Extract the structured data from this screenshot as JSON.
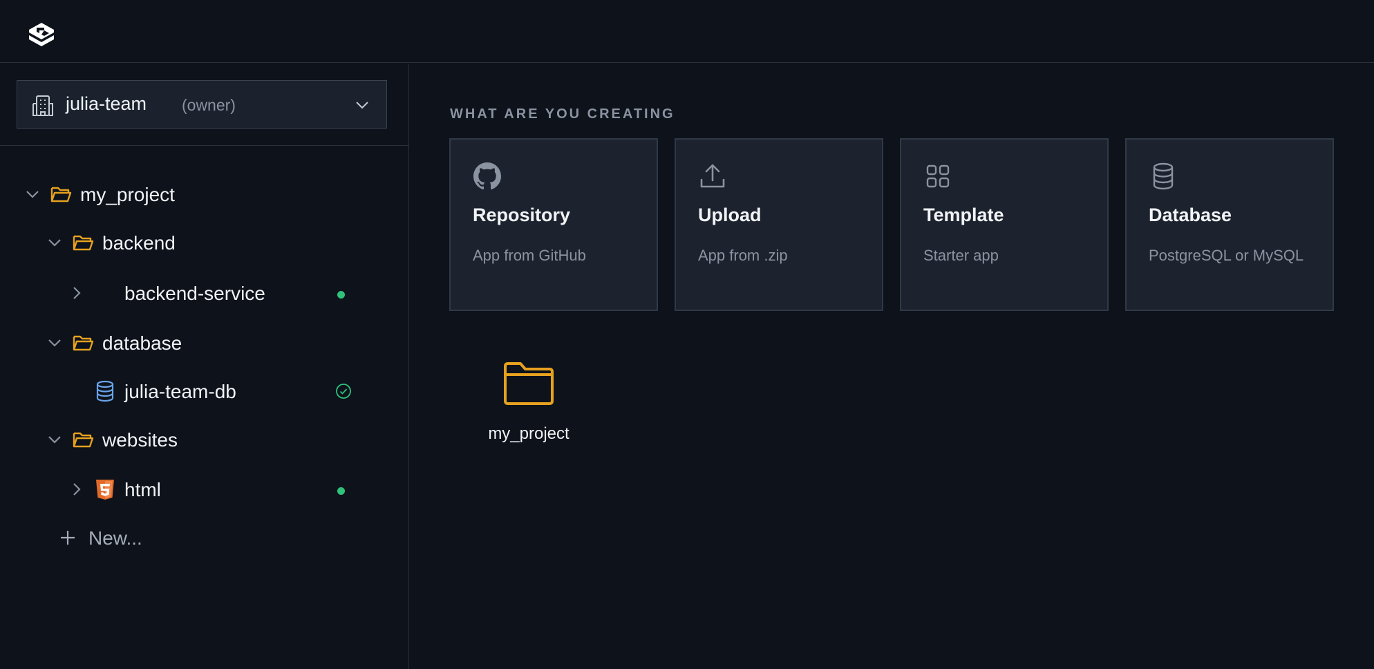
{
  "colors": {
    "folder": "#e6a11e",
    "status_green": "#2fc27a",
    "db_blue": "#6aa4ec",
    "html_orange": "#e06a2a"
  },
  "team": {
    "name": "julia-team",
    "role": "(owner)"
  },
  "tree": {
    "root": {
      "label": "my_project",
      "icon": "folder-open-icon"
    },
    "backend": {
      "label": "backend",
      "icon": "folder-open-icon"
    },
    "backend_service": {
      "label": "backend-service",
      "status": "running"
    },
    "database": {
      "label": "database",
      "icon": "folder-open-icon"
    },
    "db_item": {
      "label": "julia-team-db",
      "icon": "database-icon",
      "status": "healthy"
    },
    "websites": {
      "label": "websites",
      "icon": "folder-open-icon"
    },
    "html": {
      "label": "html",
      "icon": "html5-icon",
      "status": "running"
    },
    "new_label": "New..."
  },
  "main": {
    "section_title": "WHAT ARE YOU CREATING",
    "cards": [
      {
        "title": "Repository",
        "desc": "App from GitHub",
        "icon": "github-icon"
      },
      {
        "title": "Upload",
        "desc": "App from .zip",
        "icon": "upload-icon"
      },
      {
        "title": "Template",
        "desc": "Starter app",
        "icon": "grid-icon"
      },
      {
        "title": "Database",
        "desc": "PostgreSQL or MySQL",
        "icon": "database-icon"
      }
    ],
    "project_tile": {
      "label": "my_project",
      "icon": "folder-icon"
    }
  }
}
